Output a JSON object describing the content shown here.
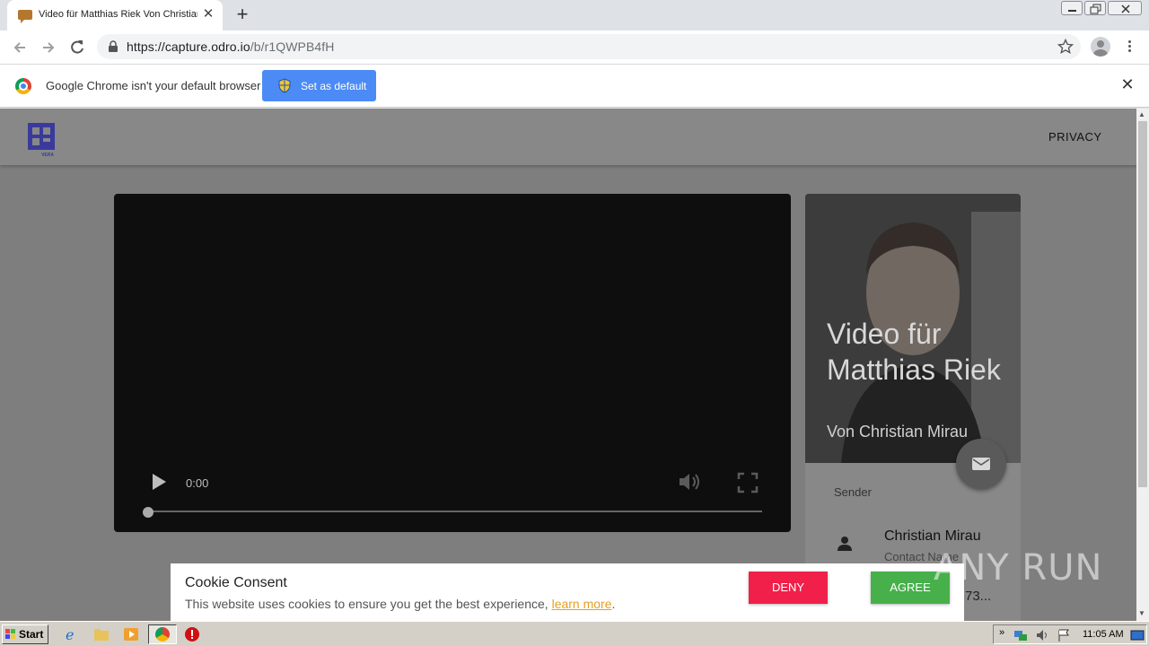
{
  "browser": {
    "tab_title": "Video für Matthias Riek Von Christian Mirau",
    "url_host": "https://capture.odro.io",
    "url_path": "/b/r1QWPB4fH"
  },
  "infobar": {
    "message": "Google Chrome isn't your default browser",
    "set_default_label": "Set as default"
  },
  "site": {
    "logo_caption": "VERA",
    "privacy_label": "PRIVACY"
  },
  "video": {
    "time": "0:00",
    "progress": 0
  },
  "card": {
    "title": "Video für Matthias Riek",
    "subtitle": "Von Christian Mirau",
    "sender_label": "Sender",
    "contact_name": "Christian Mirau",
    "contact_role": "Contact Name",
    "contact_phone": "73..."
  },
  "cookie": {
    "title": "Cookie Consent",
    "message": "This website uses cookies to ensure you get the best experience,",
    "learn_more": "learn more",
    "deny_label": "DENY",
    "agree_label": "AGREE"
  },
  "watermark": "ANY RUN",
  "taskbar": {
    "start_label": "Start",
    "clock": "11:05 AM"
  },
  "colors": {
    "deny": "#f1204a",
    "agree": "#47b04b",
    "set_default": "#4c8bf5",
    "learn_more": "#e6a020"
  },
  "icons": [
    "tab-favicon-icon",
    "close-icon",
    "new-tab-icon",
    "back-icon",
    "forward-icon",
    "reload-icon",
    "lock-icon",
    "star-icon",
    "profile-icon",
    "menu-icon",
    "chrome-logo-icon",
    "shield-icon",
    "play-icon",
    "volume-icon",
    "fullscreen-icon",
    "mail-icon",
    "person-icon"
  ]
}
